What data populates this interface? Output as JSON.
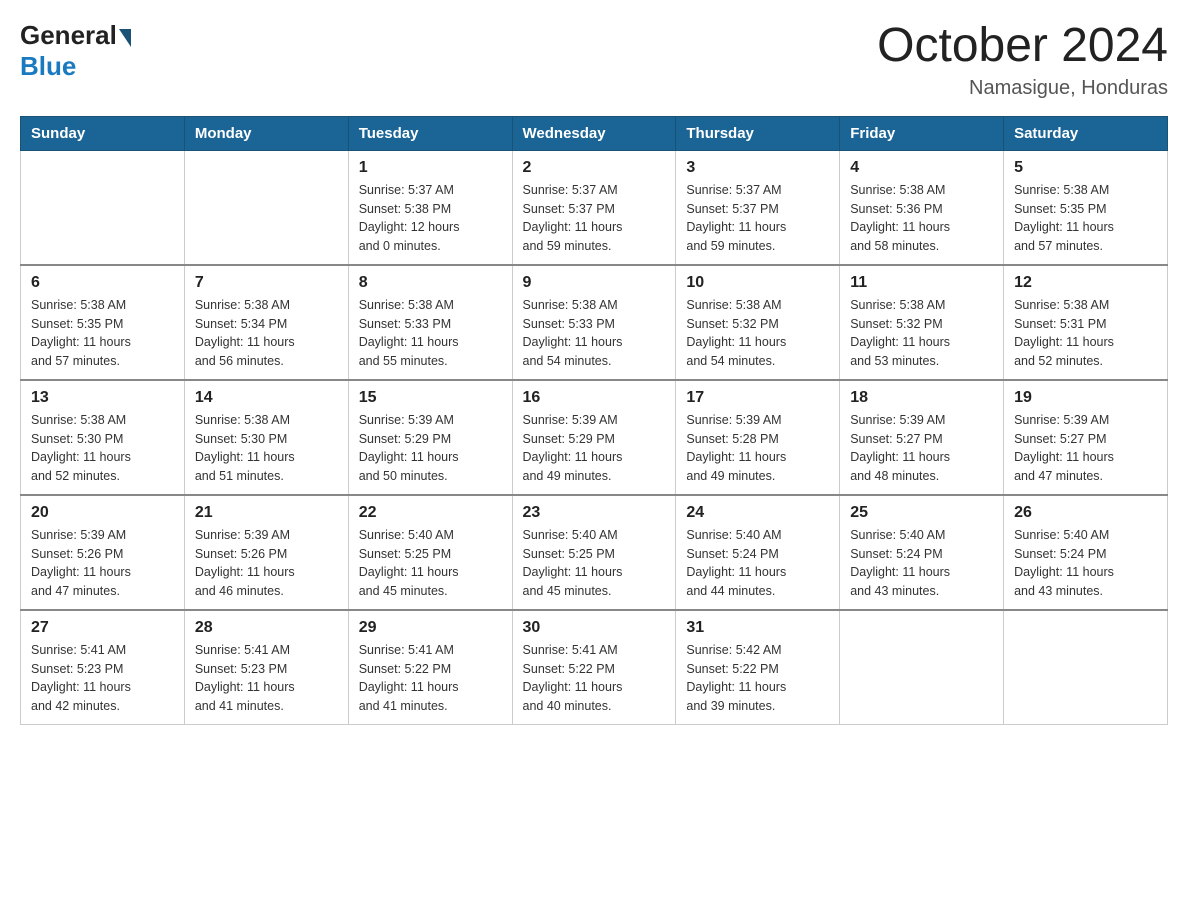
{
  "header": {
    "logo_general": "General",
    "logo_blue": "Blue",
    "month_title": "October 2024",
    "location": "Namasigue, Honduras"
  },
  "days_of_week": [
    "Sunday",
    "Monday",
    "Tuesday",
    "Wednesday",
    "Thursday",
    "Friday",
    "Saturday"
  ],
  "weeks": [
    [
      {
        "day": "",
        "info": ""
      },
      {
        "day": "",
        "info": ""
      },
      {
        "day": "1",
        "info": "Sunrise: 5:37 AM\nSunset: 5:38 PM\nDaylight: 12 hours\nand 0 minutes."
      },
      {
        "day": "2",
        "info": "Sunrise: 5:37 AM\nSunset: 5:37 PM\nDaylight: 11 hours\nand 59 minutes."
      },
      {
        "day": "3",
        "info": "Sunrise: 5:37 AM\nSunset: 5:37 PM\nDaylight: 11 hours\nand 59 minutes."
      },
      {
        "day": "4",
        "info": "Sunrise: 5:38 AM\nSunset: 5:36 PM\nDaylight: 11 hours\nand 58 minutes."
      },
      {
        "day": "5",
        "info": "Sunrise: 5:38 AM\nSunset: 5:35 PM\nDaylight: 11 hours\nand 57 minutes."
      }
    ],
    [
      {
        "day": "6",
        "info": "Sunrise: 5:38 AM\nSunset: 5:35 PM\nDaylight: 11 hours\nand 57 minutes."
      },
      {
        "day": "7",
        "info": "Sunrise: 5:38 AM\nSunset: 5:34 PM\nDaylight: 11 hours\nand 56 minutes."
      },
      {
        "day": "8",
        "info": "Sunrise: 5:38 AM\nSunset: 5:33 PM\nDaylight: 11 hours\nand 55 minutes."
      },
      {
        "day": "9",
        "info": "Sunrise: 5:38 AM\nSunset: 5:33 PM\nDaylight: 11 hours\nand 54 minutes."
      },
      {
        "day": "10",
        "info": "Sunrise: 5:38 AM\nSunset: 5:32 PM\nDaylight: 11 hours\nand 54 minutes."
      },
      {
        "day": "11",
        "info": "Sunrise: 5:38 AM\nSunset: 5:32 PM\nDaylight: 11 hours\nand 53 minutes."
      },
      {
        "day": "12",
        "info": "Sunrise: 5:38 AM\nSunset: 5:31 PM\nDaylight: 11 hours\nand 52 minutes."
      }
    ],
    [
      {
        "day": "13",
        "info": "Sunrise: 5:38 AM\nSunset: 5:30 PM\nDaylight: 11 hours\nand 52 minutes."
      },
      {
        "day": "14",
        "info": "Sunrise: 5:38 AM\nSunset: 5:30 PM\nDaylight: 11 hours\nand 51 minutes."
      },
      {
        "day": "15",
        "info": "Sunrise: 5:39 AM\nSunset: 5:29 PM\nDaylight: 11 hours\nand 50 minutes."
      },
      {
        "day": "16",
        "info": "Sunrise: 5:39 AM\nSunset: 5:29 PM\nDaylight: 11 hours\nand 49 minutes."
      },
      {
        "day": "17",
        "info": "Sunrise: 5:39 AM\nSunset: 5:28 PM\nDaylight: 11 hours\nand 49 minutes."
      },
      {
        "day": "18",
        "info": "Sunrise: 5:39 AM\nSunset: 5:27 PM\nDaylight: 11 hours\nand 48 minutes."
      },
      {
        "day": "19",
        "info": "Sunrise: 5:39 AM\nSunset: 5:27 PM\nDaylight: 11 hours\nand 47 minutes."
      }
    ],
    [
      {
        "day": "20",
        "info": "Sunrise: 5:39 AM\nSunset: 5:26 PM\nDaylight: 11 hours\nand 47 minutes."
      },
      {
        "day": "21",
        "info": "Sunrise: 5:39 AM\nSunset: 5:26 PM\nDaylight: 11 hours\nand 46 minutes."
      },
      {
        "day": "22",
        "info": "Sunrise: 5:40 AM\nSunset: 5:25 PM\nDaylight: 11 hours\nand 45 minutes."
      },
      {
        "day": "23",
        "info": "Sunrise: 5:40 AM\nSunset: 5:25 PM\nDaylight: 11 hours\nand 45 minutes."
      },
      {
        "day": "24",
        "info": "Sunrise: 5:40 AM\nSunset: 5:24 PM\nDaylight: 11 hours\nand 44 minutes."
      },
      {
        "day": "25",
        "info": "Sunrise: 5:40 AM\nSunset: 5:24 PM\nDaylight: 11 hours\nand 43 minutes."
      },
      {
        "day": "26",
        "info": "Sunrise: 5:40 AM\nSunset: 5:24 PM\nDaylight: 11 hours\nand 43 minutes."
      }
    ],
    [
      {
        "day": "27",
        "info": "Sunrise: 5:41 AM\nSunset: 5:23 PM\nDaylight: 11 hours\nand 42 minutes."
      },
      {
        "day": "28",
        "info": "Sunrise: 5:41 AM\nSunset: 5:23 PM\nDaylight: 11 hours\nand 41 minutes."
      },
      {
        "day": "29",
        "info": "Sunrise: 5:41 AM\nSunset: 5:22 PM\nDaylight: 11 hours\nand 41 minutes."
      },
      {
        "day": "30",
        "info": "Sunrise: 5:41 AM\nSunset: 5:22 PM\nDaylight: 11 hours\nand 40 minutes."
      },
      {
        "day": "31",
        "info": "Sunrise: 5:42 AM\nSunset: 5:22 PM\nDaylight: 11 hours\nand 39 minutes."
      },
      {
        "day": "",
        "info": ""
      },
      {
        "day": "",
        "info": ""
      }
    ]
  ]
}
